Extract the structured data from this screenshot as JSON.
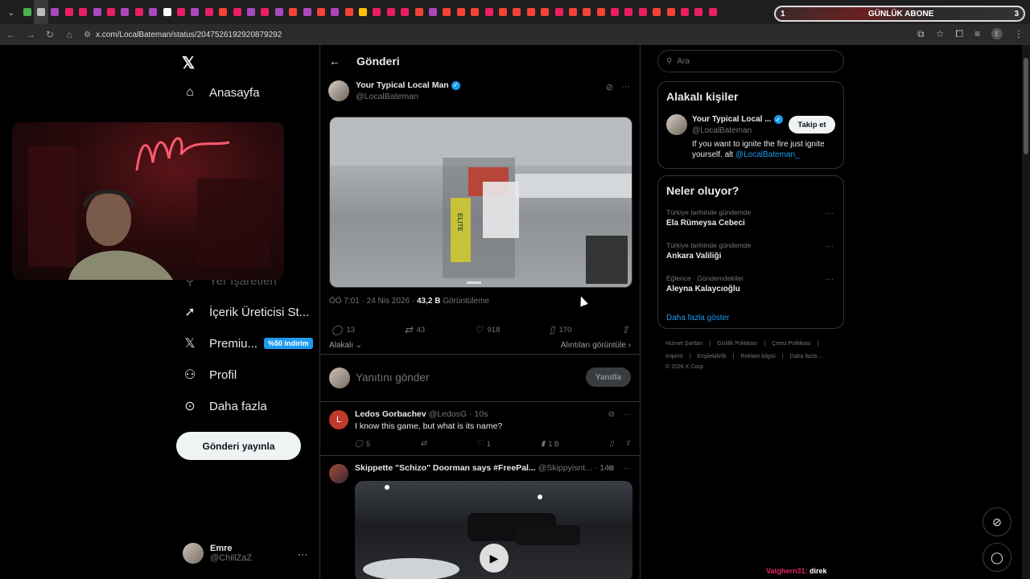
{
  "browser": {
    "url": "x.com/LocalBateman/status/2047526192920879292",
    "banner": {
      "left": "1",
      "title": "GÜNLÜK ABONE",
      "right": "3"
    },
    "tab_colors": [
      "#4caf50",
      "#bdbdbd",
      "#ab47bc",
      "#e91e63",
      "#e91e63",
      "#ab47bc",
      "#e91e63",
      "#ab47bc",
      "#e91e63",
      "#ab47bc",
      "#ffffff",
      "#e91e63",
      "#ab47bc",
      "#e91e63",
      "#f44336",
      "#e91e63",
      "#ab47bc",
      "#e91e63",
      "#ab47bc",
      "#f44336",
      "#ab47bc",
      "#f44336",
      "#ab47bc",
      "#f44336",
      "#ffc107",
      "#e91e63",
      "#e91e63",
      "#e91e63",
      "#f44336",
      "#ab47bc",
      "#f44336",
      "#f44336",
      "#f44336",
      "#e91e63",
      "#f44336",
      "#f44336",
      "#f44336",
      "#f44336",
      "#e91e63",
      "#f44336",
      "#f44336",
      "#f44336",
      "#e91e63",
      "#e91e63",
      "#e91e63",
      "#f44336",
      "#f44336",
      "#e91e63",
      "#e91e63",
      "#e91e63"
    ],
    "profile_letter": "E"
  },
  "sidebar": {
    "home": "Anasayfa",
    "partial": "Yer İşaretleri",
    "creator": "İçerik Üreticisi St...",
    "premium": "Premiu...",
    "premium_badge": "%50 indirim",
    "profile": "Profil",
    "more": "Daha fazla",
    "post_button": "Gönderi yayınla",
    "account_name": "Emre",
    "account_handle": "@ChillZaZ"
  },
  "post": {
    "header": "Gönderi",
    "author_name": "Your Typical Local Man",
    "author_handle": "@LocalBateman",
    "time": "ÖÖ 7:01 · 24 Nis 2026 · ",
    "views_count": "43,2 B",
    "views_label": " Görüntüleme",
    "replies": "13",
    "reposts": "43",
    "likes": "918",
    "bookmarks": "170",
    "filter_left": "Alakalı ⌄",
    "filter_right": "Alıntıları görüntüle ›",
    "reply_placeholder": "Yanıtını gönder",
    "reply_button": "Yanıtla",
    "game_label": "ELITE"
  },
  "replies": [
    {
      "avatar_letter": "L",
      "name": "Ledos Gorbachev",
      "handle": "@LedosG · 10s",
      "text": "I know this game, but what is its name?",
      "comments": "5",
      "likes": "1",
      "views": "1 B"
    },
    {
      "name": "Skippette \"Schizo\" Doorman says #FreePal...",
      "handle": "@Skippyisnt... · 14s"
    }
  ],
  "right": {
    "search_placeholder": "Ara",
    "who_title": "Alakalı kişiler",
    "who_name": "Your Typical Local ...",
    "who_handle": "@LocalBateman",
    "follow": "Takip et",
    "who_bio": "If you want to ignite the fire just ignite yourself. alt ",
    "who_bio_link": "@LocalBateman_",
    "trends_title": "Neler oluyor?",
    "trends": [
      {
        "context": "Türkiye tarihinde gündemde",
        "name": "Ela Rümeysa Cebeci"
      },
      {
        "context": "Türkiye tarihinde gündemde",
        "name": "Ankara Valiliği"
      },
      {
        "context": "Eğlence · Gündemdekiler",
        "name": "Aleyna Kalaycıoğlu"
      }
    ],
    "show_more": "Daha fazla göster",
    "footer1": [
      "Hizmet Şartları",
      "|",
      "Gizlilik Politikası",
      "|",
      "Çerez Politikası",
      "|"
    ],
    "footer2": [
      "Imprint",
      "|",
      "Erişilebilirlik",
      "|",
      "Reklam bilgisi",
      "|",
      "Daha fazla ..."
    ],
    "copyright": "© 2026 X Corp."
  },
  "chat": {
    "user": "Vatghern31:",
    "message": " direk"
  }
}
